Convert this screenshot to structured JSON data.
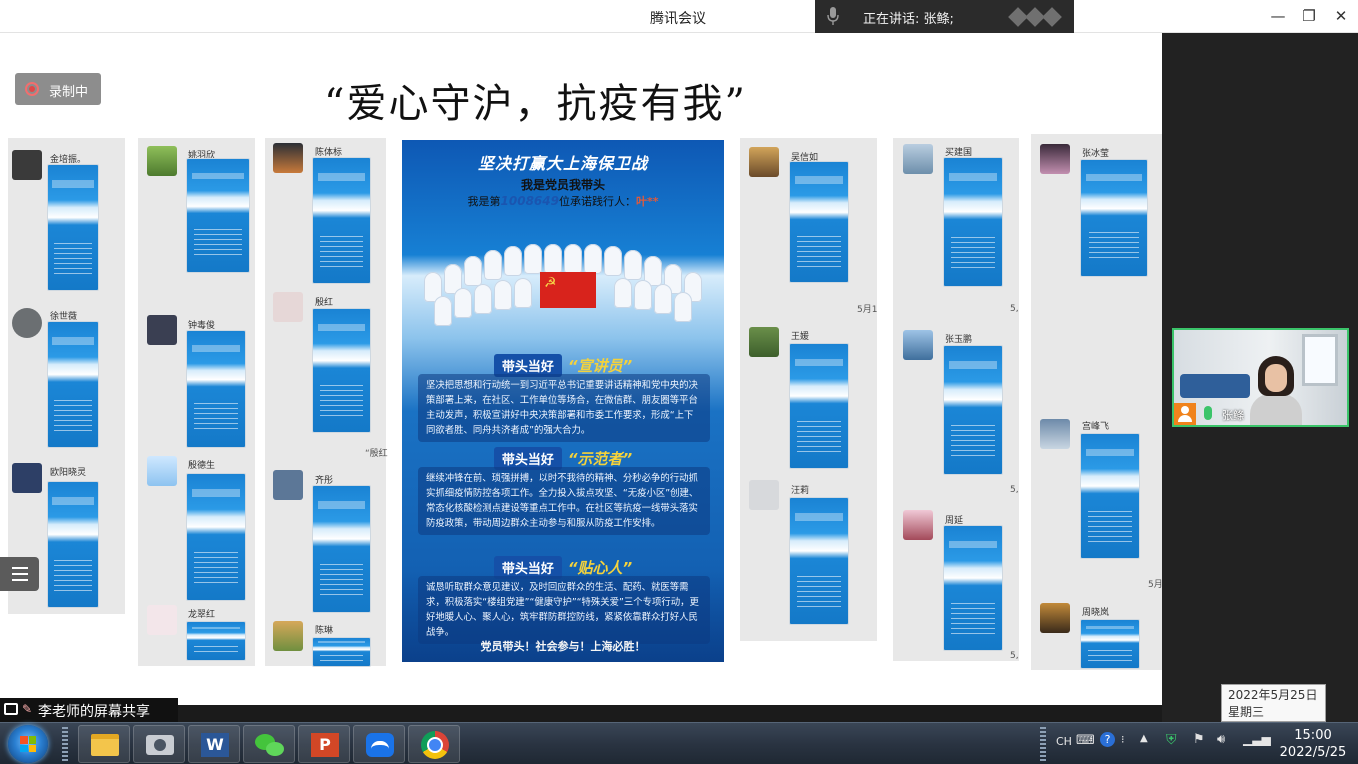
{
  "window": {
    "title": "腾讯会议",
    "speaking_label": "正在讲话: 张鲦;",
    "controls": {
      "minimize": "—",
      "maximize": "❐",
      "close": "✕"
    }
  },
  "recording": {
    "label": "录制中"
  },
  "slide": {
    "title": "“爱心守沪，抗疫有我”"
  },
  "chat_columns": [
    {
      "names": [
        "金培振。",
        "徐世薇",
        "欧阳晓灵"
      ]
    },
    {
      "names": [
        "姚羽欣",
        "钟毒俊",
        "殷德生",
        "龙翠红"
      ]
    },
    {
      "names": [
        "陈体标",
        "殷红",
        "齐彤",
        "陈琳"
      ]
    },
    {
      "names": [
        "吴信如",
        "王媛",
        "汪莉"
      ]
    },
    {
      "names": [
        "买建国",
        "张玉鹏",
        "周延"
      ]
    },
    {
      "names": [
        "张冰莹",
        "宫峰飞",
        "周晓岚"
      ]
    }
  ],
  "date_fragments": [
    "5月1",
    "5,",
    "5,",
    "5,",
    "5月",
    "“殷红"
  ],
  "poster": {
    "title": "坚决打赢大上海保卫战",
    "line1": "我是党员我带头",
    "line2_prefix": "我是第",
    "line2_number": "1008649",
    "line2_mid": "位承诺践行人：",
    "line2_name": "叶**",
    "sections": [
      {
        "tag": "带头当好",
        "role": "“宣讲员”",
        "body": "坚决把思想和行动统一到习近平总书记重要讲话精神和党中央的决策部署上来，在社区、工作单位等场合，在微信群、朋友圈等平台主动发声，积极宣讲好中央决策部署和市委工作要求，形成“上下同欲者胜、同舟共济者成”的强大合力。"
      },
      {
        "tag": "带头当好",
        "role": "“示范者”",
        "body": "继续冲锋在前、琐强拼搏，以时不我待的精神、分秒必争的行动抓实抓细疫情防控各项工作。全力投入拔点攻坚、“无疫小区”创建、常态化核酸检测点建设等重点工作中。在社区等抗疫一线带头落实防疫政策，带动周边群众主动参与和服从防疫工作安排。"
      },
      {
        "tag": "带头当好",
        "role": "“贴心人”",
        "body": "诚恳听取群众意见建议，及时回应群众的生活、配药、就医等需求，积极落实“楼组党建”“健康守护”“特殊关爱”三个专项行动，更好地暖人心、聚人心，筑牢群防群控防线，紧紧依靠群众打好人民战争。"
      }
    ],
    "footer": "党员带头！社会参与！上海必胜！"
  },
  "video_tile": {
    "name": "张鲦"
  },
  "screen_share": {
    "label": "李老师的屏幕共享"
  },
  "date_tooltip": {
    "date": "2022年5月25日",
    "weekday": "星期三"
  },
  "taskbar": {
    "apps": [
      "file-explorer",
      "camera",
      "word",
      "wechat",
      "powerpoint",
      "tencent-meeting",
      "chrome"
    ],
    "tray": {
      "lang": "CH",
      "clock_time": "15:00",
      "clock_date": "2022/5/25"
    }
  },
  "colors": {
    "accent_green": "#3bc46a",
    "poster_blue": "#1780d4",
    "flag_red": "#d8231c"
  }
}
